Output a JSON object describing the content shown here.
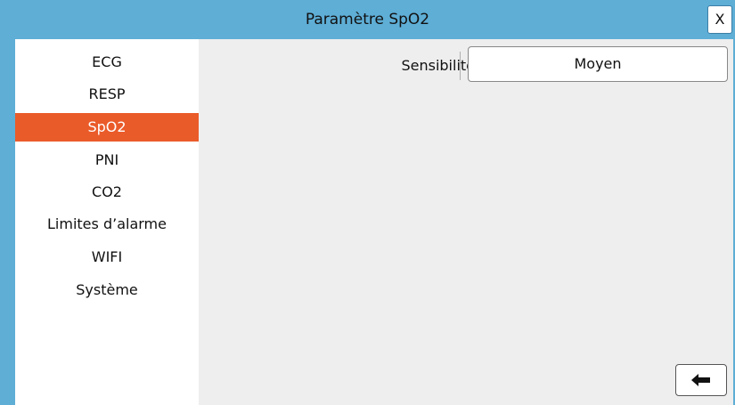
{
  "header": {
    "title": "Paramètre SpO2",
    "close_label": "X"
  },
  "sidebar": {
    "items": [
      {
        "label": "ECG",
        "active": false
      },
      {
        "label": "RESP",
        "active": false
      },
      {
        "label": "SpO2",
        "active": true
      },
      {
        "label": "PNI",
        "active": false
      },
      {
        "label": "CO2",
        "active": false
      },
      {
        "label": "Limites d’alarme",
        "active": false
      },
      {
        "label": "WIFI",
        "active": false
      },
      {
        "label": "Système",
        "active": false
      }
    ]
  },
  "settings": {
    "sensitivity_label": "Sensibilité",
    "sensitivity_value": "Moyen"
  },
  "footer": {
    "back_icon": "arrow-left-icon"
  },
  "colors": {
    "titlebar": "#5eaed6",
    "active_item": "#ea5b2a",
    "content_bg": "#eeeeee"
  }
}
